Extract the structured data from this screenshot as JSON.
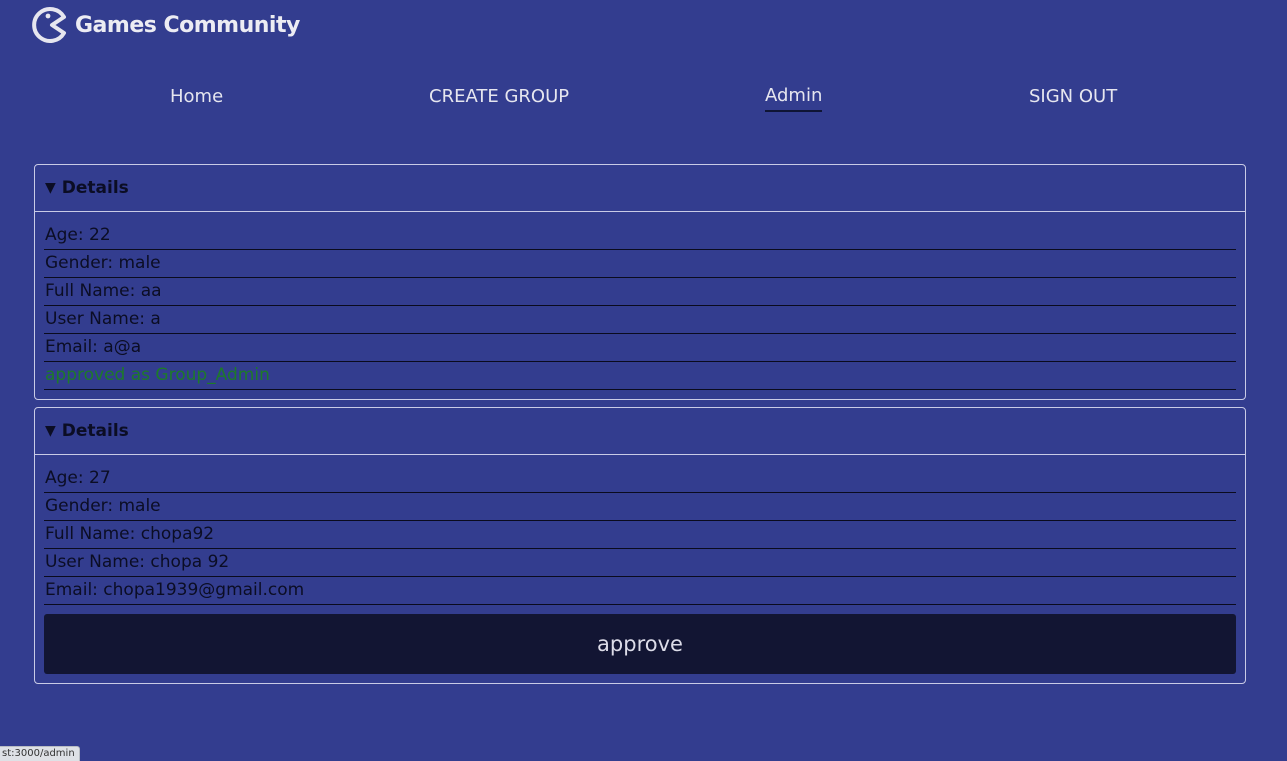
{
  "brand": {
    "logo_icon": "pacman-icon",
    "name": "Games Community"
  },
  "nav": {
    "items": [
      {
        "label": "Home"
      },
      {
        "label": "CREATE GROUP"
      },
      {
        "label": "Admin",
        "active": true
      },
      {
        "label": "SIGN OUT"
      }
    ]
  },
  "requests": [
    {
      "summary": "Details",
      "marker": "▼",
      "age": "Age: 22",
      "gender": "Gender: male",
      "full_name": "Full Name: aa",
      "user_name": "User Name: a",
      "email": "Email: a@a",
      "status": "approved as Group_Admin"
    },
    {
      "summary": "Details",
      "marker": "▼",
      "age": "Age: 27",
      "gender": "Gender: male",
      "full_name": "Full Name: chopa92",
      "user_name": "User Name: chopa 92",
      "email": "Email: chopa1939@gmail.com",
      "action_label": "approve"
    }
  ],
  "status_bar": {
    "url": "st:3000/admin"
  },
  "colors": {
    "background": "#333d8f",
    "button": "#121533",
    "approved_text": "#1d7a2a"
  }
}
